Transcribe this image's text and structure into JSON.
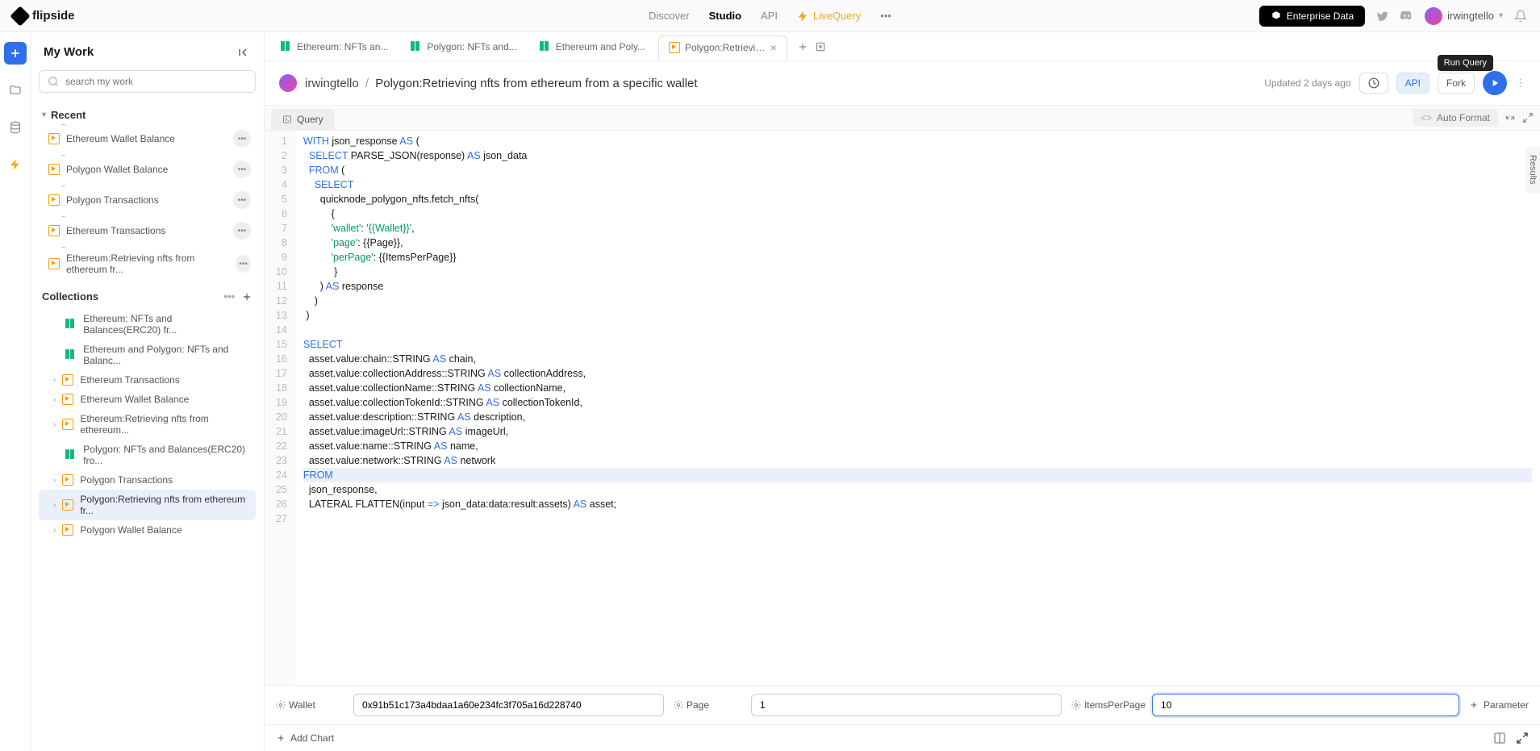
{
  "brand": "flipside",
  "nav": {
    "discover": "Discover",
    "studio": "Studio",
    "api": "API",
    "livequery": "LiveQuery",
    "enterprise": "Enterprise Data",
    "user": "irwingtello"
  },
  "sidebar": {
    "title": "My Work",
    "search_placeholder": "search my work",
    "recent_header": "Recent",
    "collections_header": "Collections",
    "recent": [
      {
        "label": "Ethereum Wallet Balance"
      },
      {
        "label": "Polygon Wallet Balance"
      },
      {
        "label": "Polygon Transactions"
      },
      {
        "label": "Ethereum Transactions"
      },
      {
        "label": "Ethereum:Retrieving nfts from ethereum fr..."
      }
    ],
    "collections": [
      {
        "label": "Ethereum: NFTs and Balances(ERC20) fr...",
        "type": "dash"
      },
      {
        "label": "Ethereum and Polygon: NFTs and Balanc...",
        "type": "dash"
      },
      {
        "label": "Ethereum Transactions",
        "type": "query",
        "expandable": true
      },
      {
        "label": "Ethereum Wallet Balance",
        "type": "query",
        "expandable": true
      },
      {
        "label": "Ethereum:Retrieving nfts from ethereum...",
        "type": "query",
        "expandable": true
      },
      {
        "label": "Polygon: NFTs and Balances(ERC20) fro...",
        "type": "dash"
      },
      {
        "label": "Polygon Transactions",
        "type": "query",
        "expandable": true
      },
      {
        "label": "Polygon:Retrieving nfts from ethereum fr...",
        "type": "query",
        "expandable": true,
        "selected": true
      },
      {
        "label": "Polygon Wallet Balance",
        "type": "query",
        "expandable": true
      }
    ]
  },
  "tabs": [
    {
      "label": "Ethereum: NFTs an...",
      "type": "dash"
    },
    {
      "label": "Polygon: NFTs and...",
      "type": "dash"
    },
    {
      "label": "Ethereum and Poly...",
      "type": "dash"
    },
    {
      "label": "Polygon:Retrieving...",
      "type": "query",
      "active": true
    }
  ],
  "breadcrumb": {
    "user": "irwingtello",
    "title": "Polygon:Retrieving nfts from ethereum from a specific wallet",
    "updated": "Updated 2 days ago",
    "api": "API",
    "fork": "Fork",
    "tooltip": "Run Query"
  },
  "querytab": "Query",
  "autoformat": "Auto Format",
  "results_label": "Results",
  "code_lines": [
    {
      "n": 1,
      "html": "<span class='kw'>WITH</span> json_response <span class='kw'>AS</span> ("
    },
    {
      "n": 2,
      "html": "  <span class='kw'>SELECT</span> PARSE_JSON(response) <span class='kw'>AS</span> json_data"
    },
    {
      "n": 3,
      "html": "  <span class='kw'>FROM</span> ("
    },
    {
      "n": 4,
      "html": "    <span class='kw'>SELECT</span>"
    },
    {
      "n": 5,
      "html": "      quicknode_polygon_nfts.fetch_nfts("
    },
    {
      "n": 6,
      "html": "          {"
    },
    {
      "n": 7,
      "html": "          <span class='str'>'wallet'</span>: <span class='str'>'{{Wallet}}'</span>,"
    },
    {
      "n": 8,
      "html": "          <span class='str'>'page'</span>: {{Page}},"
    },
    {
      "n": 9,
      "html": "          <span class='str'>'perPage'</span>: {{ItemsPerPage}}"
    },
    {
      "n": 10,
      "html": "           }"
    },
    {
      "n": 11,
      "html": "      ) <span class='kw'>AS</span> response"
    },
    {
      "n": 12,
      "html": "    )"
    },
    {
      "n": 13,
      "html": " )"
    },
    {
      "n": 14,
      "html": ""
    },
    {
      "n": 15,
      "html": "<span class='kw'>SELECT</span>"
    },
    {
      "n": 16,
      "html": "  asset.value:chain::STRING <span class='kw'>AS</span> chain,"
    },
    {
      "n": 17,
      "html": "  asset.value:collectionAddress::STRING <span class='kw'>AS</span> collectionAddress,"
    },
    {
      "n": 18,
      "html": "  asset.value:collectionName::STRING <span class='kw'>AS</span> collectionName,"
    },
    {
      "n": 19,
      "html": "  asset.value:collectionTokenId::STRING <span class='kw'>AS</span> collectionTokenId,"
    },
    {
      "n": 20,
      "html": "  asset.value:description::STRING <span class='kw'>AS</span> description,"
    },
    {
      "n": 21,
      "html": "  asset.value:imageUrl::STRING <span class='kw'>AS</span> imageUrl,"
    },
    {
      "n": 22,
      "html": "  asset.value:name::STRING <span class='kw'>AS</span> name,"
    },
    {
      "n": 23,
      "html": "  asset.value:network::STRING <span class='kw'>AS</span> network"
    },
    {
      "n": 24,
      "html": "<span class='kw'>FROM</span>",
      "hl": true
    },
    {
      "n": 25,
      "html": "  json_response,"
    },
    {
      "n": 26,
      "html": "  LATERAL FLATTEN(input <span class='kw'>=></span> json_data:data:result:assets) <span class='kw'>AS</span> asset;"
    },
    {
      "n": 27,
      "html": ""
    }
  ],
  "params": {
    "wallet_label": "Wallet",
    "wallet_value": "0x91b51c173a4bdaa1a60e234fc3f705a16d228740",
    "page_label": "Page",
    "page_value": "1",
    "ipp_label": "ItemsPerPage",
    "ipp_value": "10",
    "add": "Parameter"
  },
  "addchart": "Add Chart"
}
